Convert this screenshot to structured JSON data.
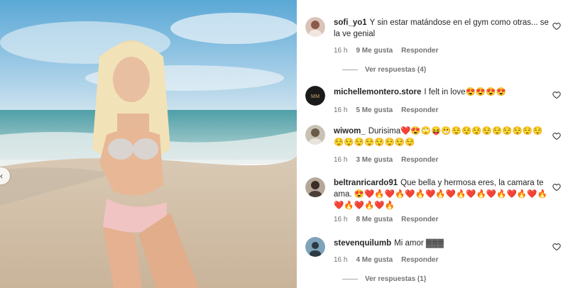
{
  "post": {
    "prev_icon": "chevron-left-icon"
  },
  "comments": [
    {
      "username": "sofi_yo1",
      "text": "Y sin estar matándose en el gym como otras... se la ve genial",
      "time": "16 h",
      "likes": "9 Me gusta",
      "reply": "Responder",
      "view_replies": "Ver respuestas (4)"
    },
    {
      "username": "michellemontero.store",
      "text": "I felt in love😍😍😍😍",
      "time": "16 h",
      "likes": "5 Me gusta",
      "reply": "Responder"
    },
    {
      "username": "wiwom_",
      "text": "Durisima❤️😍🙄😝😬😌😌😌😌😌😌😌😌😌😌😌😌😌😌😌😌😌",
      "time": "16 h",
      "likes": "3 Me gusta",
      "reply": "Responder"
    },
    {
      "username": "beltranricardo91",
      "text": "Que bella y hermosa eres, la camara te ama. 😍❤️🔥❤️🔥❤️🔥❤️🔥❤️🔥❤️🔥❤️🔥❤️🔥❤️🔥❤️🔥❤️🔥❤️🔥",
      "time": "16 h",
      "likes": "8 Me gusta",
      "reply": "Responder"
    },
    {
      "username": "stevenquilumb",
      "text": "Mi amor ▓▓▓",
      "time": "16 h",
      "likes": "4 Me gusta",
      "reply": "Responder",
      "view_replies": "Ver respuestas (1)"
    }
  ],
  "icons": {
    "like": "heart-icon",
    "prev": "chevron-left-icon"
  }
}
